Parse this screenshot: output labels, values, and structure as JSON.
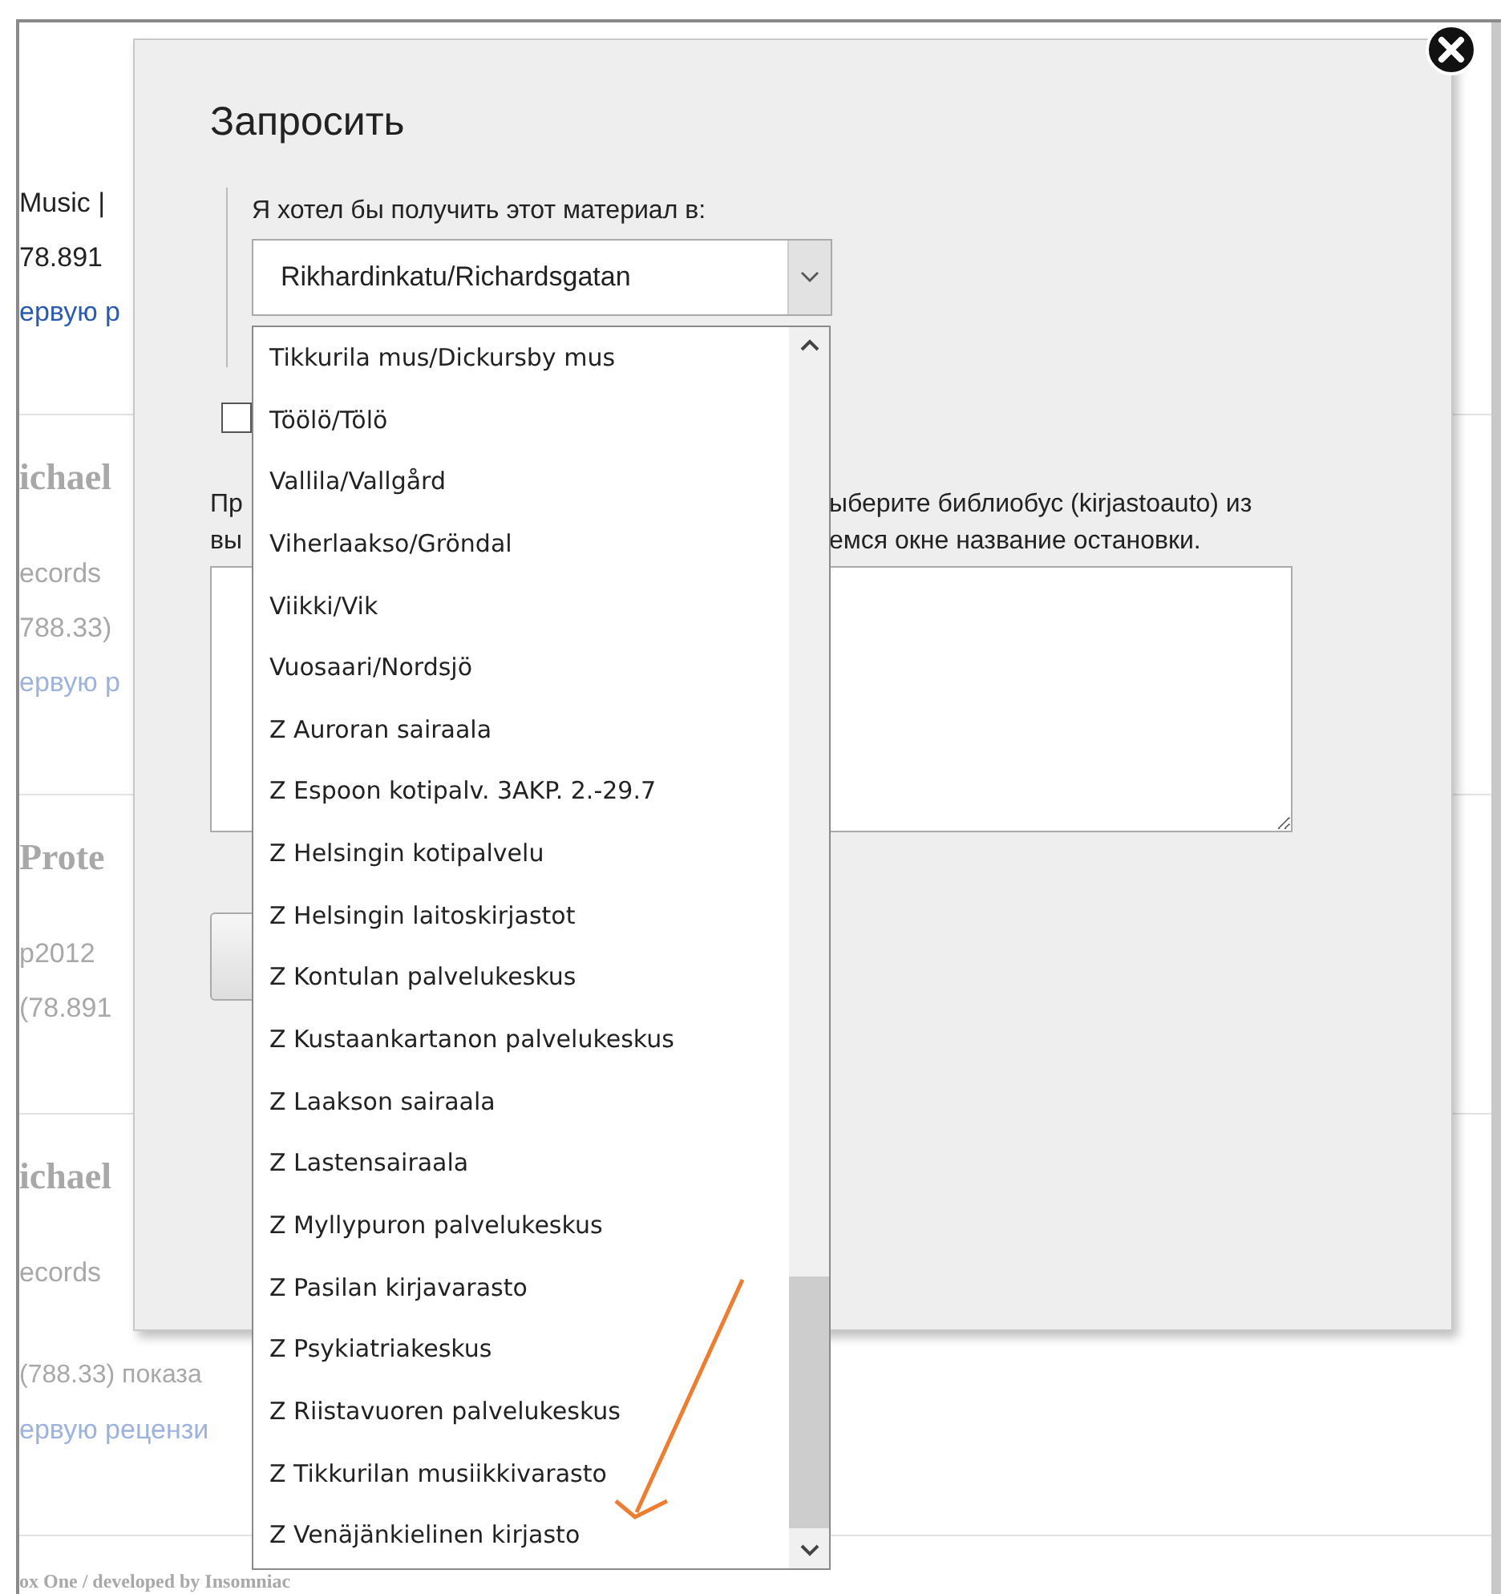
{
  "background": {
    "sections": [
      {
        "faded": false,
        "lines": [
          {
            "text": "Music  |",
            "kind": "plain"
          },
          {
            "text": "78.891",
            "kind": "plain"
          },
          {
            "text": "ервую р",
            "kind": "link"
          }
        ]
      },
      {
        "faded": true,
        "heading": "ichael",
        "lines": [
          {
            "text": "ecords",
            "kind": "plain"
          },
          {
            "text": "788.33)",
            "kind": "plain"
          },
          {
            "text": "ервую р",
            "kind": "link"
          }
        ]
      },
      {
        "faded": true,
        "heading": "Prote",
        "lines": [
          {
            "text": "p2012",
            "kind": "plain"
          },
          {
            "text": "(78.891",
            "kind": "plain"
          }
        ]
      },
      {
        "faded": true,
        "heading": "ichael",
        "lines": [
          {
            "text": "ecords",
            "kind": "plain"
          },
          {
            "text": "(788.33)  показа",
            "kind": "plain"
          },
          {
            "text": "ервую рецензи",
            "kind": "link"
          }
        ]
      },
      {
        "faded": true,
        "heading": "ox One / developed by Insomniac"
      }
    ]
  },
  "dialog": {
    "title": "Запросить",
    "pickup_label": "Я хотел бы получить этот материал в:",
    "pickup_select": {
      "value": "Rikhardinkatu/Richardsgatan",
      "expanded": true,
      "options": [
        {
          "label": "Tikkurila mus/Dickursby mus",
          "selected": false
        },
        {
          "label": "Töölö/Tölö",
          "selected": false
        },
        {
          "label": "Vallila/Vallgård",
          "selected": false
        },
        {
          "label": "Viherlaakso/Gröndal",
          "selected": false
        },
        {
          "label": "Viikki/Vik",
          "selected": false
        },
        {
          "label": "Vuosaari/Nordsjö",
          "selected": false
        },
        {
          "label": "Z Auroran sairaala",
          "selected": false
        },
        {
          "label": "Z Espoon kotipalv. 3AKP. 2.-29.7",
          "selected": false
        },
        {
          "label": "Z Helsingin kotipalvelu",
          "selected": false
        },
        {
          "label": "Z Helsingin laitoskirjastot",
          "selected": false
        },
        {
          "label": "Z Kontulan palvelukeskus",
          "selected": false
        },
        {
          "label": "Z Kustaankartanon palvelukeskus",
          "selected": false
        },
        {
          "label": "Z Laakson sairaala",
          "selected": false
        },
        {
          "label": "Z Lastensairaala",
          "selected": false
        },
        {
          "label": "Z Myllypuron palvelukeskus",
          "selected": false
        },
        {
          "label": "Z Pasilan kirjavarasto",
          "selected": false
        },
        {
          "label": "Z Psykiatriakeskus",
          "selected": false
        },
        {
          "label": "Z Riistavuoren palvelukeskus",
          "selected": false
        },
        {
          "label": "Z Tikkurilan musiikkivarasto",
          "selected": false
        },
        {
          "label": "Z Venäjänkielinen kirjasto",
          "selected": false
        }
      ]
    },
    "checkbox": {
      "checked": false
    },
    "note_lines": [
      {
        "left": "Пр",
        "right": "ыберите библиобус (kirjastoauto) из"
      },
      {
        "left": "вы",
        "right": "емся окне название остановки."
      }
    ]
  }
}
